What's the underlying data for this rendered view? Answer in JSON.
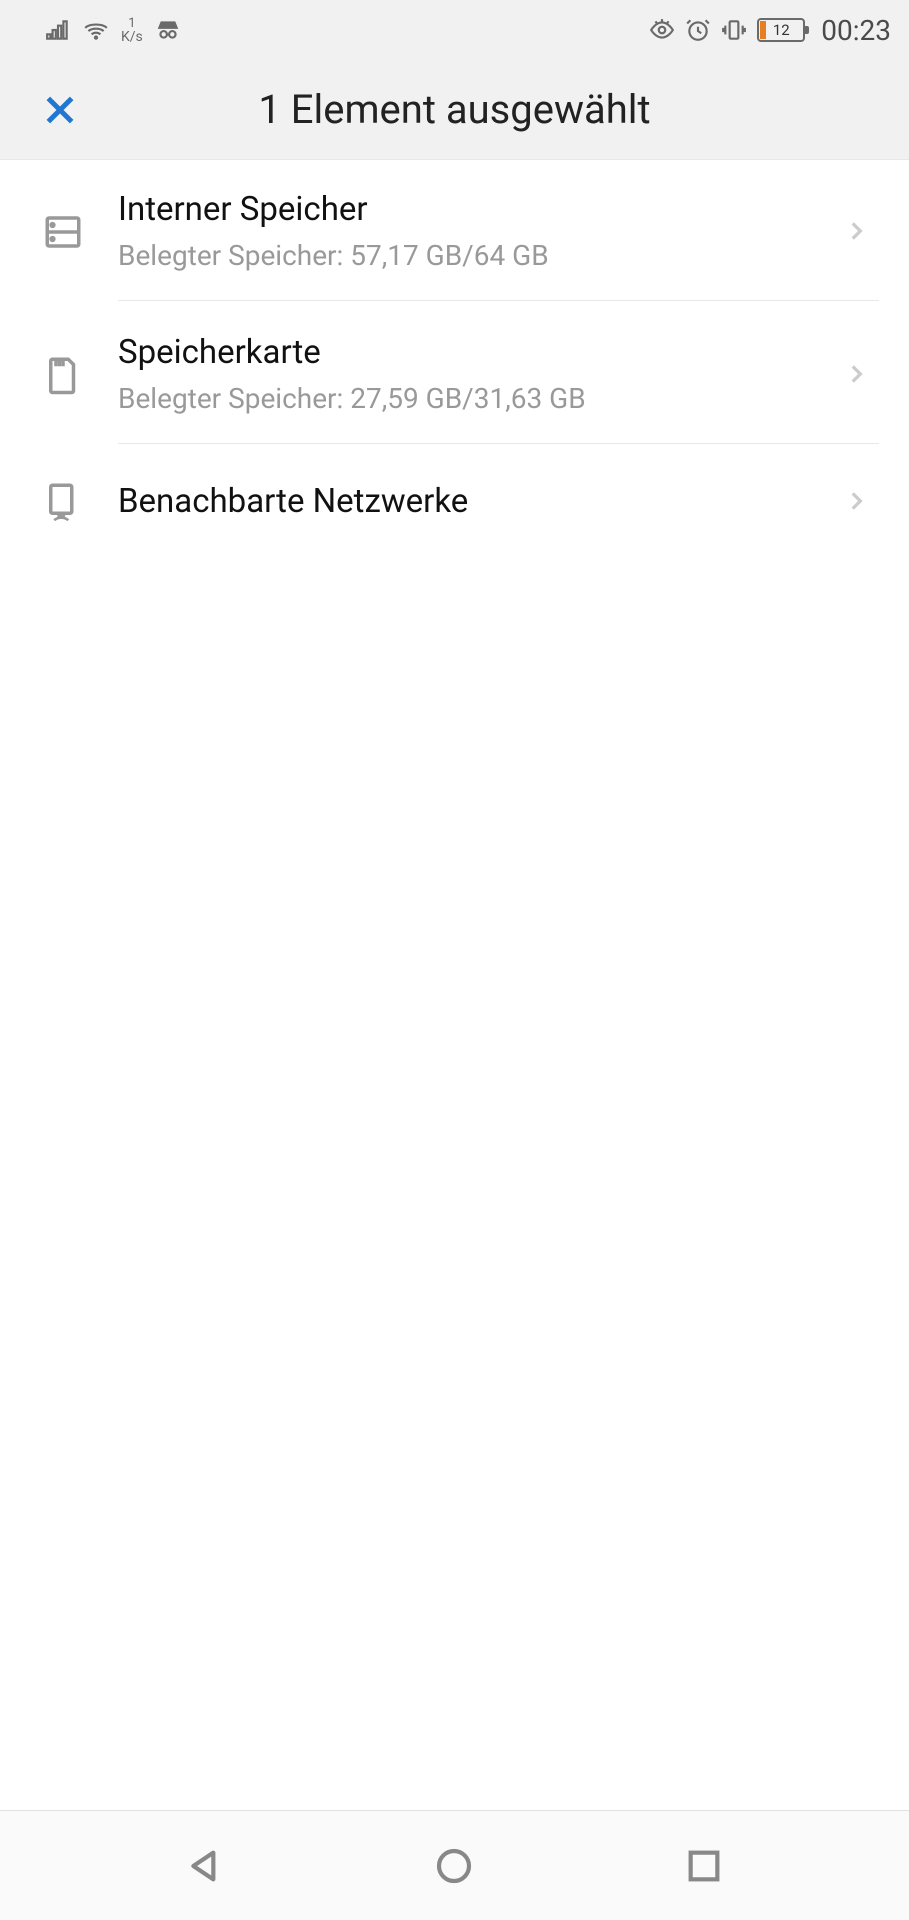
{
  "statusBar": {
    "netSpeedNum": "1",
    "netSpeedUnit": "K/s",
    "batteryPercent": "12",
    "time": "00:23"
  },
  "header": {
    "title": "1 Element ausgewählt"
  },
  "list": {
    "items": [
      {
        "title": "Interner Speicher",
        "subtitle": "Belegter Speicher: 57,17 GB/64 GB",
        "icon": "storage-icon"
      },
      {
        "title": "Speicherkarte",
        "subtitle": "Belegter Speicher: 27,59 GB/31,63 GB",
        "icon": "sdcard-icon"
      },
      {
        "title": "Benachbarte Netzwerke",
        "subtitle": "",
        "icon": "network-device-icon"
      }
    ]
  }
}
